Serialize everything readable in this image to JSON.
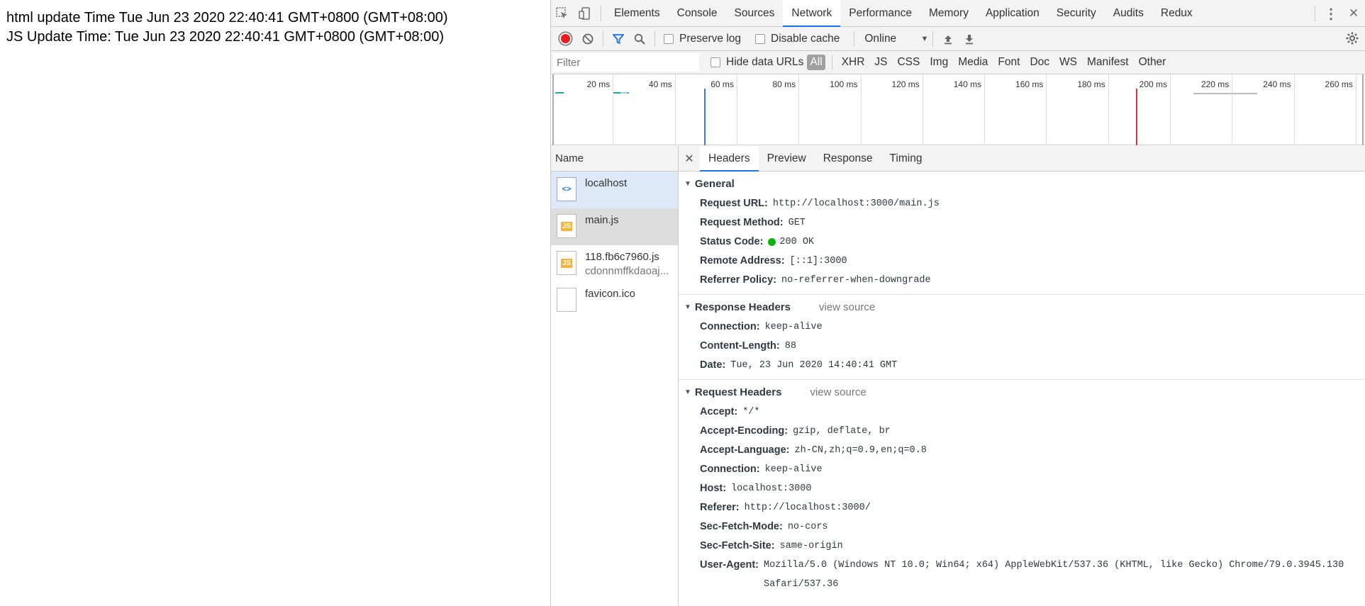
{
  "page": {
    "line1": "html update Time Tue Jun 23 2020 22:40:41 GMT+0800 (GMT+08:00)",
    "line2": "JS Update Time: Tue Jun 23 2020 22:40:41 GMT+0800 (GMT+08:00)"
  },
  "tabs": [
    "Elements",
    "Console",
    "Sources",
    "Network",
    "Performance",
    "Memory",
    "Application",
    "Security",
    "Audits",
    "Redux"
  ],
  "active_tab": "Network",
  "toolbar": {
    "preserve_log": "Preserve log",
    "disable_cache": "Disable cache",
    "throttle": "Online"
  },
  "filterbar": {
    "placeholder": "Filter",
    "hide_data_urls": "Hide data URLs",
    "types": [
      "All",
      "XHR",
      "JS",
      "CSS",
      "Img",
      "Media",
      "Font",
      "Doc",
      "WS",
      "Manifest",
      "Other"
    ]
  },
  "timeline": {
    "ticks": [
      "20 ms",
      "40 ms",
      "60 ms",
      "80 ms",
      "100 ms",
      "120 ms",
      "140 ms",
      "160 ms",
      "180 ms",
      "200 ms",
      "220 ms",
      "240 ms",
      "260 ms"
    ]
  },
  "requests": {
    "header": "Name",
    "items": [
      {
        "name": "localhost",
        "sub": ""
      },
      {
        "name": "main.js",
        "sub": ""
      },
      {
        "name": "118.fb6c7960.js",
        "sub": "cdonnmffkdaoaj..."
      },
      {
        "name": "favicon.ico",
        "sub": ""
      }
    ]
  },
  "detail_tabs": [
    "Headers",
    "Preview",
    "Response",
    "Timing"
  ],
  "general": {
    "title": "General",
    "rows": [
      {
        "k": "Request URL:",
        "v": "http://localhost:3000/main.js"
      },
      {
        "k": "Request Method:",
        "v": "GET"
      },
      {
        "k": "Status Code:",
        "v": "200 OK"
      },
      {
        "k": "Remote Address:",
        "v": "[::1]:3000"
      },
      {
        "k": "Referrer Policy:",
        "v": "no-referrer-when-downgrade"
      }
    ]
  },
  "response_headers": {
    "title": "Response Headers",
    "view_source": "view source",
    "rows": [
      {
        "k": "Connection:",
        "v": "keep-alive"
      },
      {
        "k": "Content-Length:",
        "v": "88"
      },
      {
        "k": "Date:",
        "v": "Tue, 23 Jun 2020 14:40:41 GMT"
      }
    ]
  },
  "request_headers": {
    "title": "Request Headers",
    "view_source": "view source",
    "rows": [
      {
        "k": "Accept:",
        "v": "*/*"
      },
      {
        "k": "Accept-Encoding:",
        "v": "gzip, deflate, br"
      },
      {
        "k": "Accept-Language:",
        "v": "zh-CN,zh;q=0.9,en;q=0.8"
      },
      {
        "k": "Connection:",
        "v": "keep-alive"
      },
      {
        "k": "Host:",
        "v": "localhost:3000"
      },
      {
        "k": "Referer:",
        "v": "http://localhost:3000/"
      },
      {
        "k": "Sec-Fetch-Mode:",
        "v": "no-cors"
      },
      {
        "k": "Sec-Fetch-Site:",
        "v": "same-origin"
      },
      {
        "k": "User-Agent:",
        "v": "Mozilla/5.0 (Windows NT 10.0; Win64; x64) AppleWebKit/537.36 (KHTML, like Gecko) Chrome/79.0.3945.130 Safari/537.36"
      }
    ]
  },
  "colors": {
    "accent": "#1a73e8",
    "record": "#e81e1e",
    "status_ok": "#0bb30b"
  }
}
